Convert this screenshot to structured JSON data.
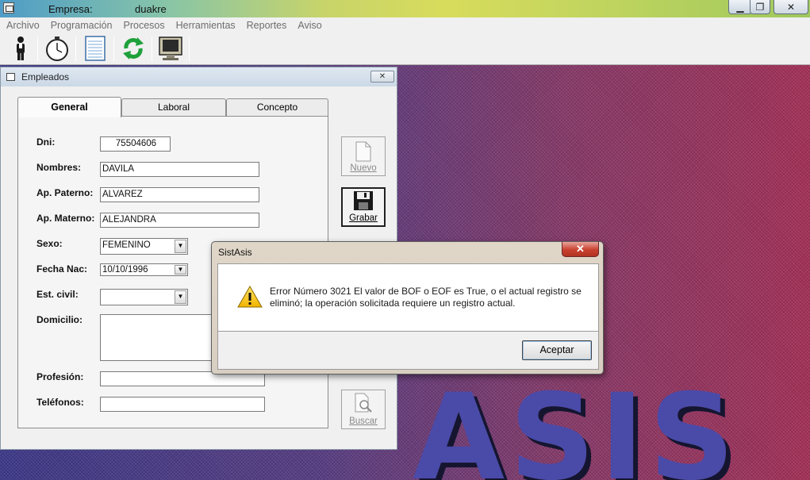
{
  "window": {
    "empresa_label": "Empresa:",
    "empresa_value": "duakre",
    "controls": {
      "minimize": "▁",
      "maximize": "❐",
      "close": "✕"
    }
  },
  "menu": [
    "Archivo",
    "Programación",
    "Procesos",
    "Herramientas",
    "Reportes",
    "Aviso"
  ],
  "toolbar": {
    "icons": [
      "person-icon",
      "stopwatch-icon",
      "notepad-icon",
      "refresh-icon",
      "monitor-icon"
    ]
  },
  "background": {
    "logo_text": "ASIS"
  },
  "empleados": {
    "title": "Empleados",
    "close_glyph": "✕",
    "tabs": [
      "General",
      "Laboral",
      "Concepto"
    ],
    "active_tab": "General",
    "fields": {
      "dni": {
        "label": "Dni:",
        "value": "75504606"
      },
      "nombres": {
        "label": "Nombres:",
        "value": "DAVILA"
      },
      "ap_paterno": {
        "label": "Ap. Paterno:",
        "value": "ALVAREZ"
      },
      "ap_materno": {
        "label": "Ap. Materno:",
        "value": "ALEJANDRA"
      },
      "sexo": {
        "label": "Sexo:",
        "value": "FEMENINO"
      },
      "fecha_nac": {
        "label": "Fecha Nac:",
        "value": "10/10/1996"
      },
      "est_civil": {
        "label": "Est. civil:",
        "value": ""
      },
      "domicilio": {
        "label": "Domicilio:",
        "value": ""
      },
      "profesion": {
        "label": "Profesión:",
        "value": ""
      },
      "telefonos": {
        "label": "Teléfonos:",
        "value": ""
      }
    },
    "side_buttons": {
      "nuevo": {
        "label": "Nuevo",
        "enabled": false
      },
      "grabar": {
        "label": "Grabar",
        "enabled": true
      },
      "buscar": {
        "label": "Buscar",
        "enabled": false
      }
    }
  },
  "dialog": {
    "title": "SistAsis",
    "close_glyph": "✕",
    "message": "Error Número 3021 El valor de BOF o EOF es True, o el actual registro se eliminó; la operación solicitada requiere un registro actual.",
    "ok_label": "Aceptar"
  }
}
